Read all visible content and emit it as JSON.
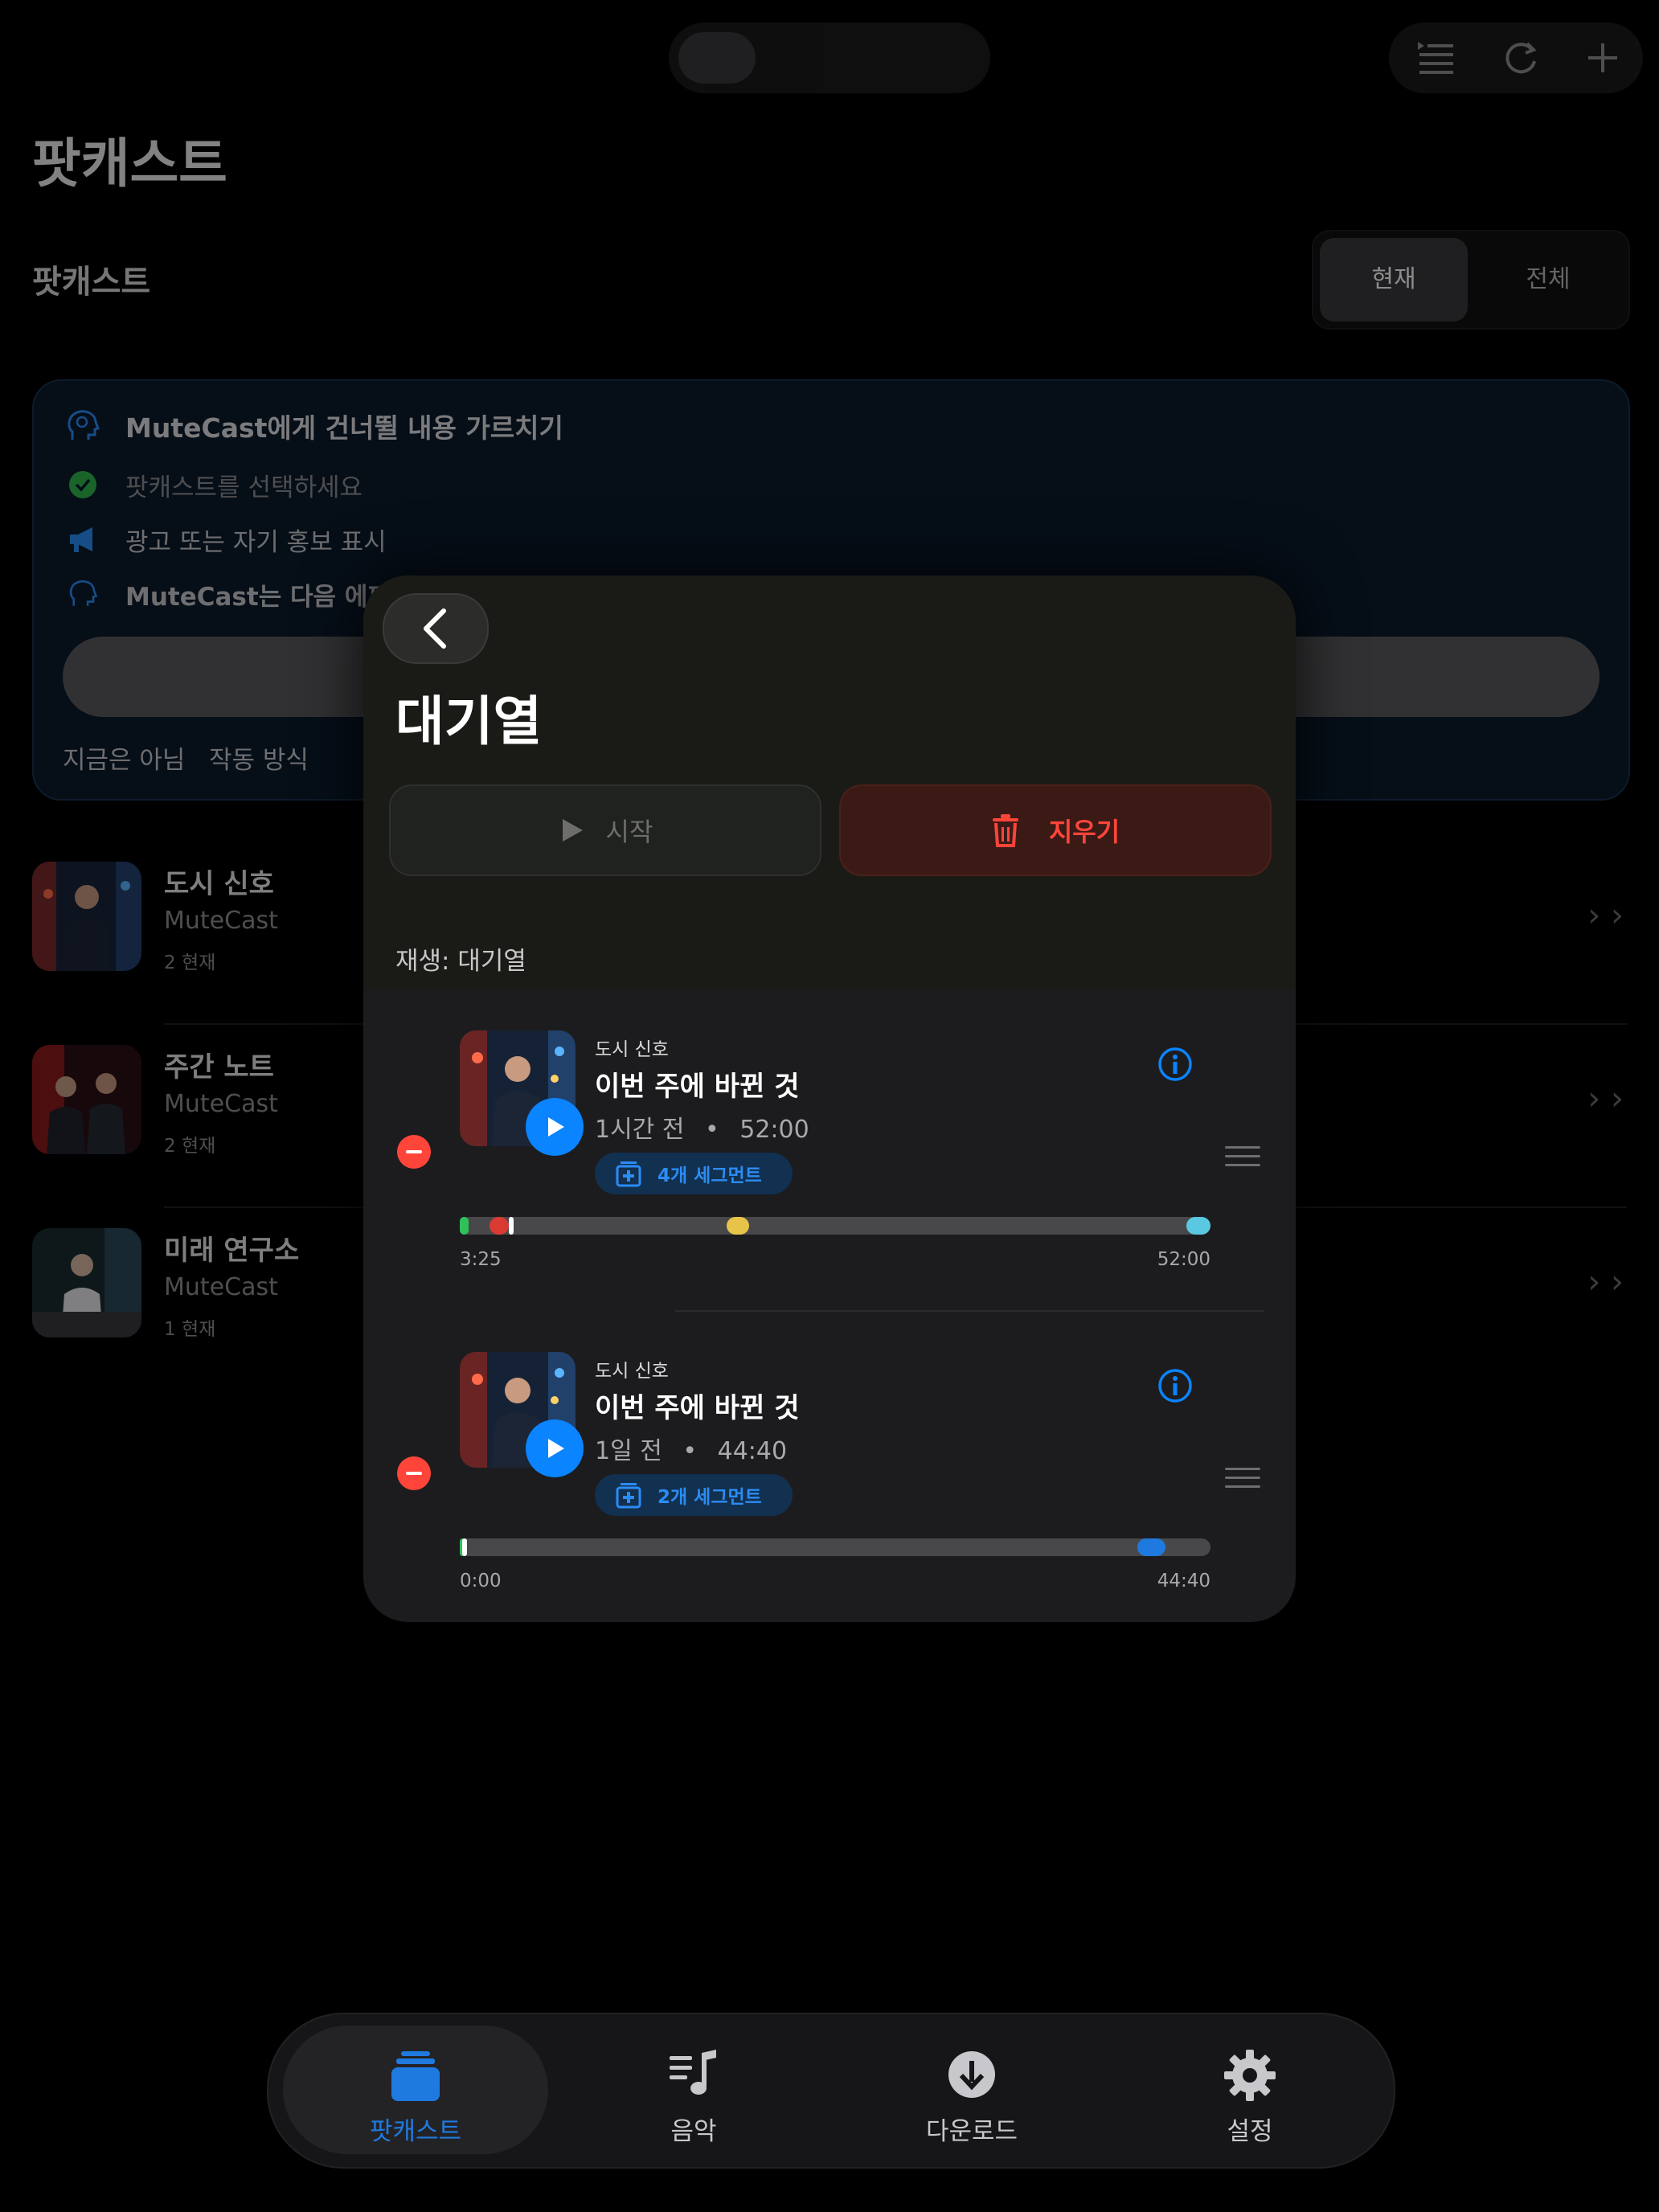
{
  "header": {
    "title": "팟캐스트",
    "subtitle": "팟캐스트"
  },
  "filter": {
    "options": [
      "현재",
      "전체"
    ],
    "selected": "현재"
  },
  "teach_card": {
    "title": "MuteCast에게 건너뛸 내용 가르치기",
    "steps": [
      {
        "text": "팟캐스트를 선택하세요",
        "icon": "check-circle-icon"
      },
      {
        "text": "광고 또는 자기 홍보 표시",
        "icon": "megaphone-icon"
      },
      {
        "text": "MuteCast는 다음 에피소",
        "icon": "brain-head-icon"
      }
    ],
    "links": [
      "지금은 아님",
      "작동 방식"
    ]
  },
  "podcasts": [
    {
      "name": "도시 신호",
      "publisher": "MuteCast",
      "count": "2 현재"
    },
    {
      "name": "주간 노트",
      "publisher": "MuteCast",
      "count": "2 현재"
    },
    {
      "name": "미래 연구소",
      "publisher": "MuteCast",
      "count": "1 현재"
    }
  ],
  "modal": {
    "title": "대기열",
    "start_label": "시작",
    "clear_label": "지우기",
    "section_label": "재생: 대기열",
    "items": [
      {
        "show": "도시 신호",
        "title": "이번 주에 바뀐 것",
        "age": "1시간 전",
        "duration": "52:00",
        "segments_label": "4개 세그먼트",
        "progress_start": "3:25",
        "progress_end": "52:00",
        "markers": [
          {
            "start": 0.0,
            "end": 0.012,
            "color": "#30c05a"
          },
          {
            "start": 0.04,
            "end": 0.065,
            "color": "#d93a32"
          },
          {
            "start": 0.065,
            "end": 0.072,
            "color": "#ffffff"
          },
          {
            "start": 0.355,
            "end": 0.385,
            "color": "#e8c34a"
          },
          {
            "start": 0.968,
            "end": 1.0,
            "color": "#5ac8e0"
          }
        ]
      },
      {
        "show": "도시 신호",
        "title": "이번 주에 바뀐 것",
        "age": "1일 전",
        "duration": "44:40",
        "segments_label": "2개 세그먼트",
        "progress_start": "0:00",
        "progress_end": "44:40",
        "markers": [
          {
            "start": 0.0,
            "end": 0.008,
            "color": "#30c05a"
          },
          {
            "start": 0.003,
            "end": 0.01,
            "color": "#ffffff"
          },
          {
            "start": 0.903,
            "end": 0.94,
            "color": "#1f7ae0"
          }
        ]
      }
    ]
  },
  "tabs": [
    {
      "label": "팟캐스트",
      "icon": "podcasts-stack-icon",
      "active": true
    },
    {
      "label": "음악",
      "icon": "music-list-icon",
      "active": false
    },
    {
      "label": "다운로드",
      "icon": "download-circle-icon",
      "active": false
    },
    {
      "label": "설정",
      "icon": "gear-icon",
      "active": false
    }
  ],
  "colors": {
    "accent": "#0a84ff",
    "destructive": "#ff453a",
    "background": "#000000"
  }
}
